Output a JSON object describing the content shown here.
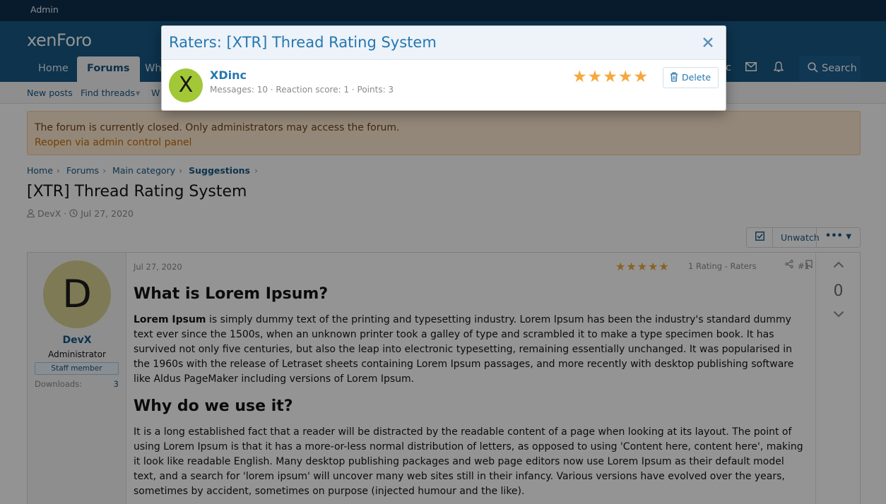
{
  "admin_bar": {
    "label": "Admin"
  },
  "header": {
    "logo": "xenForo",
    "nav_tabs": [
      {
        "label": "Home"
      },
      {
        "label": "Forums"
      },
      {
        "label": "Wh"
      }
    ],
    "nav_right": [
      "c"
    ],
    "search_label": "Search"
  },
  "sub_nav": {
    "items": [
      "New posts",
      "Find threads",
      "W"
    ]
  },
  "notice": {
    "message": "The forum is currently closed. Only administrators may access the forum.",
    "link": "Reopen via admin control panel"
  },
  "breadcrumb": {
    "items": [
      "Home",
      "Forums",
      "Main category",
      "Suggestions"
    ]
  },
  "thread": {
    "title": "[XTR] Thread Rating System",
    "author": "DevX",
    "date": "Jul 27, 2020",
    "watch_label": "Unwatch",
    "more_label": "•••"
  },
  "post": {
    "date": "Jul 27, 2020",
    "rating_text": "1 Rating - Raters",
    "number": "#1",
    "user": {
      "avatar_letter": "D",
      "name": "DevX",
      "title": "Administrator",
      "banner": "Staff member",
      "stat_label": "Downloads:",
      "stat_value": "3"
    },
    "heading1": "What is Lorem Ipsum?",
    "para1_bold": "Lorem Ipsum",
    "para1": " is simply dummy text of the printing and typesetting industry. Lorem Ipsum has been the industry's standard dummy text ever since the 1500s, when an unknown printer took a galley of type and scrambled it to make a type specimen book. It has survived not only five centuries, but also the leap into electronic typesetting, remaining essentially unchanged. It was popularised in the 1960s with the release of Letraset sheets containing Lorem Ipsum passages, and more recently with desktop publishing software like Aldus PageMaker including versions of Lorem Ipsum.",
    "heading2": "Why do we use it?",
    "para2": "It is a long established fact that a reader will be distracted by the readable content of a page when looking at its layout. The point of using Lorem Ipsum is that it has a more-or-less normal distribution of letters, as opposed to using 'Content here, content here', making it look like readable English. Many desktop publishing packages and web page editors now use Lorem Ipsum as their default model text, and a search for 'lorem ipsum' will uncover many web sites still in their infancy. Various versions have evolved over the years, sometimes by accident, sometimes on purpose (injected humour and the like).",
    "vote_count": "0"
  },
  "modal": {
    "title": "Raters: [XTR] Thread Rating System",
    "close_icon": "close-icon",
    "rater": {
      "avatar_letter": "X",
      "name": "XDinc",
      "stats": "Messages: 10 · Reaction score: 1 · Points: 3",
      "rating_stars": 5,
      "delete_label": "Delete"
    }
  },
  "colors": {
    "header_bg": "#185886",
    "admin_bar_bg": "#0f2f4f",
    "accent": "#2577b1",
    "star": "#f6a83c",
    "notice_bg": "#fde9d0"
  }
}
